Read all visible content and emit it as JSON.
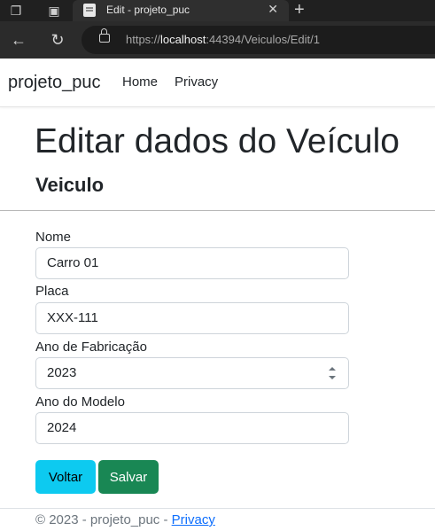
{
  "browser": {
    "tab_title": "Edit - projeto_puc",
    "url_prefix": "https://",
    "url_host": "localhost",
    "url_rest": ":44394/Veiculos/Edit/1",
    "tab_close": "✕",
    "new_tab": "+"
  },
  "navbar": {
    "brand": "projeto_puc",
    "links": [
      "Home",
      "Privacy"
    ]
  },
  "page": {
    "title": "Editar dados do Veículo",
    "subtitle": "Veiculo"
  },
  "form": {
    "nome": {
      "label": "Nome",
      "value": "Carro 01"
    },
    "placa": {
      "label": "Placa",
      "value": "XXX-111"
    },
    "ano_fabricacao": {
      "label": "Ano de Fabricação",
      "value": "2023"
    },
    "ano_modelo": {
      "label": "Ano do Modelo",
      "value": "2024"
    },
    "back_label": "Voltar",
    "save_label": "Salvar"
  },
  "footer": {
    "text": "© 2023 - projeto_puc - ",
    "link": "Privacy"
  },
  "colors": {
    "btn_back": "#0dcaf0",
    "btn_save": "#198754",
    "link": "#0d6efd"
  }
}
